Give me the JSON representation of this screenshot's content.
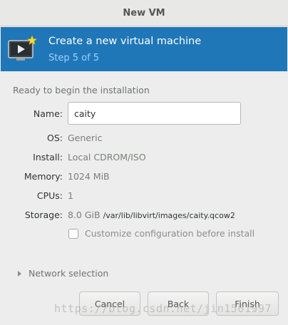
{
  "window": {
    "title": "New VM"
  },
  "banner": {
    "icon": "vm-screen-icon",
    "heading": "Create a new virtual machine",
    "step": "Step 5 of 5",
    "color": "#1f77b8"
  },
  "summary": {
    "section_label": "Ready to begin the installation",
    "name_label": "Name:",
    "name_value": "caity",
    "os_label": "OS:",
    "os_value": "Generic",
    "install_label": "Install:",
    "install_value": "Local CDROM/ISO",
    "memory_label": "Memory:",
    "memory_value": "1024 MiB",
    "cpus_label": "CPUs:",
    "cpus_value": "1",
    "storage_label": "Storage:",
    "storage_size": "8.0 GiB",
    "storage_path": "/var/lib/libvirt/images/caity.qcow2"
  },
  "customize": {
    "label": "Customize configuration before install",
    "checked": false
  },
  "network": {
    "label": "Network selection",
    "expanded": false
  },
  "buttons": {
    "cancel": "Cancel",
    "back": "Back",
    "finish": "Finish"
  },
  "watermark": "https://blog.csdn.net/jin1501997"
}
